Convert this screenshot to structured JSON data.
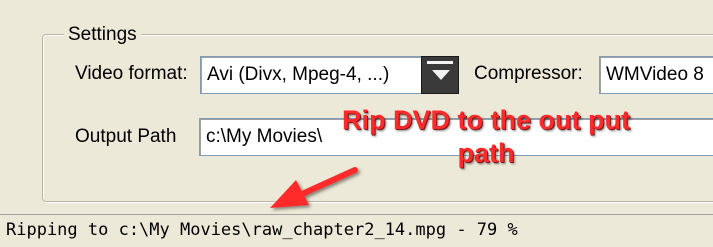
{
  "settings": {
    "group_label": "Settings",
    "video_format_label": "Video format:",
    "video_format_value": "Avi (Divx, Mpeg-4, ...)",
    "compressor_label": "Compressor:",
    "compressor_value": "WMVideo 8",
    "output_path_label": "Output Path",
    "output_path_value": "c:\\My Movies\\"
  },
  "annotation": {
    "text_line1": "Rip DVD to the out put",
    "text_line2": "path",
    "color": "#ff2a2a"
  },
  "status": {
    "text": "Ripping to c:\\My Movies\\raw_chapter2_14.mpg - 79 %",
    "progress_percent": 79
  },
  "icons": {
    "dropdown": "chevron-down-icon",
    "arrow": "red-arrow-icon"
  }
}
